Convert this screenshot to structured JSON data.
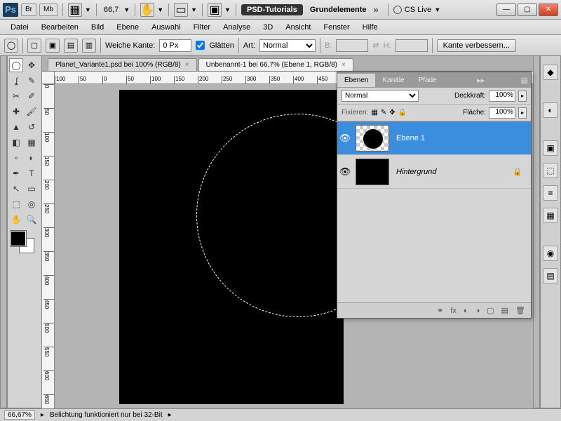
{
  "title": {
    "zoom": "66,7",
    "workspace_btn": "PSD-Tutorials",
    "workspace_label": "Grundelemente",
    "cslive": "CS Live"
  },
  "menu": [
    "Datei",
    "Bearbeiten",
    "Bild",
    "Ebene",
    "Auswahl",
    "Filter",
    "Analyse",
    "3D",
    "Ansicht",
    "Fenster",
    "Hilfe"
  ],
  "options": {
    "feather_label": "Weiche Kante:",
    "feather_value": "0 Px",
    "antialias_label": "Glätten",
    "style_label": "Art:",
    "style_value": "Normal",
    "w_label": "B:",
    "h_label": "H:",
    "refine_btn": "Kante verbessern..."
  },
  "docs": {
    "tab1": "Planet_Variante1.psd bei 100% (RGB/8)",
    "tab2": "Unbenannt-1 bei 66,7% (Ebene 1, RGB/8)"
  },
  "ruler_h": [
    "100",
    "50",
    "0",
    "50",
    "100",
    "150",
    "200",
    "250",
    "300",
    "350",
    "400",
    "450"
  ],
  "ruler_v": [
    "0",
    "50",
    "100",
    "150",
    "200",
    "250",
    "300",
    "350",
    "400",
    "450",
    "500",
    "550",
    "600",
    "650"
  ],
  "layers_panel": {
    "tabs": [
      "Ebenen",
      "Kanäle",
      "Pfade"
    ],
    "blend": "Normal",
    "opacity_label": "Deckkraft:",
    "opacity_value": "100%",
    "lock_label": "Fixieren:",
    "fill_label": "Fläche:",
    "fill_value": "100%",
    "layer1": "Ebene 1",
    "bg": "Hintergrund"
  },
  "status": {
    "zoom": "66,67%",
    "msg": "Belichtung funktioniert nur bei 32-Bit"
  }
}
